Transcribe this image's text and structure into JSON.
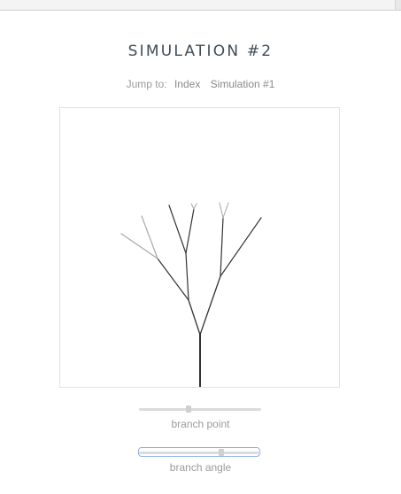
{
  "page": {
    "title": "SIMULATION #2",
    "jump_label": "Jump to:",
    "jump_links": [
      "Index",
      "Simulation #1"
    ]
  },
  "controls": [
    {
      "label": "branch point",
      "value_fraction": 0.4,
      "focused": false
    },
    {
      "label": "branch angle",
      "value_fraction": 0.68,
      "focused": true
    }
  ],
  "colors": {
    "title": "#3f4d57",
    "muted_text": "#9b9b9b",
    "branch_dark": "#333333",
    "branch_light": "#a8a8a8",
    "focus_ring": "#8fb1e6"
  }
}
